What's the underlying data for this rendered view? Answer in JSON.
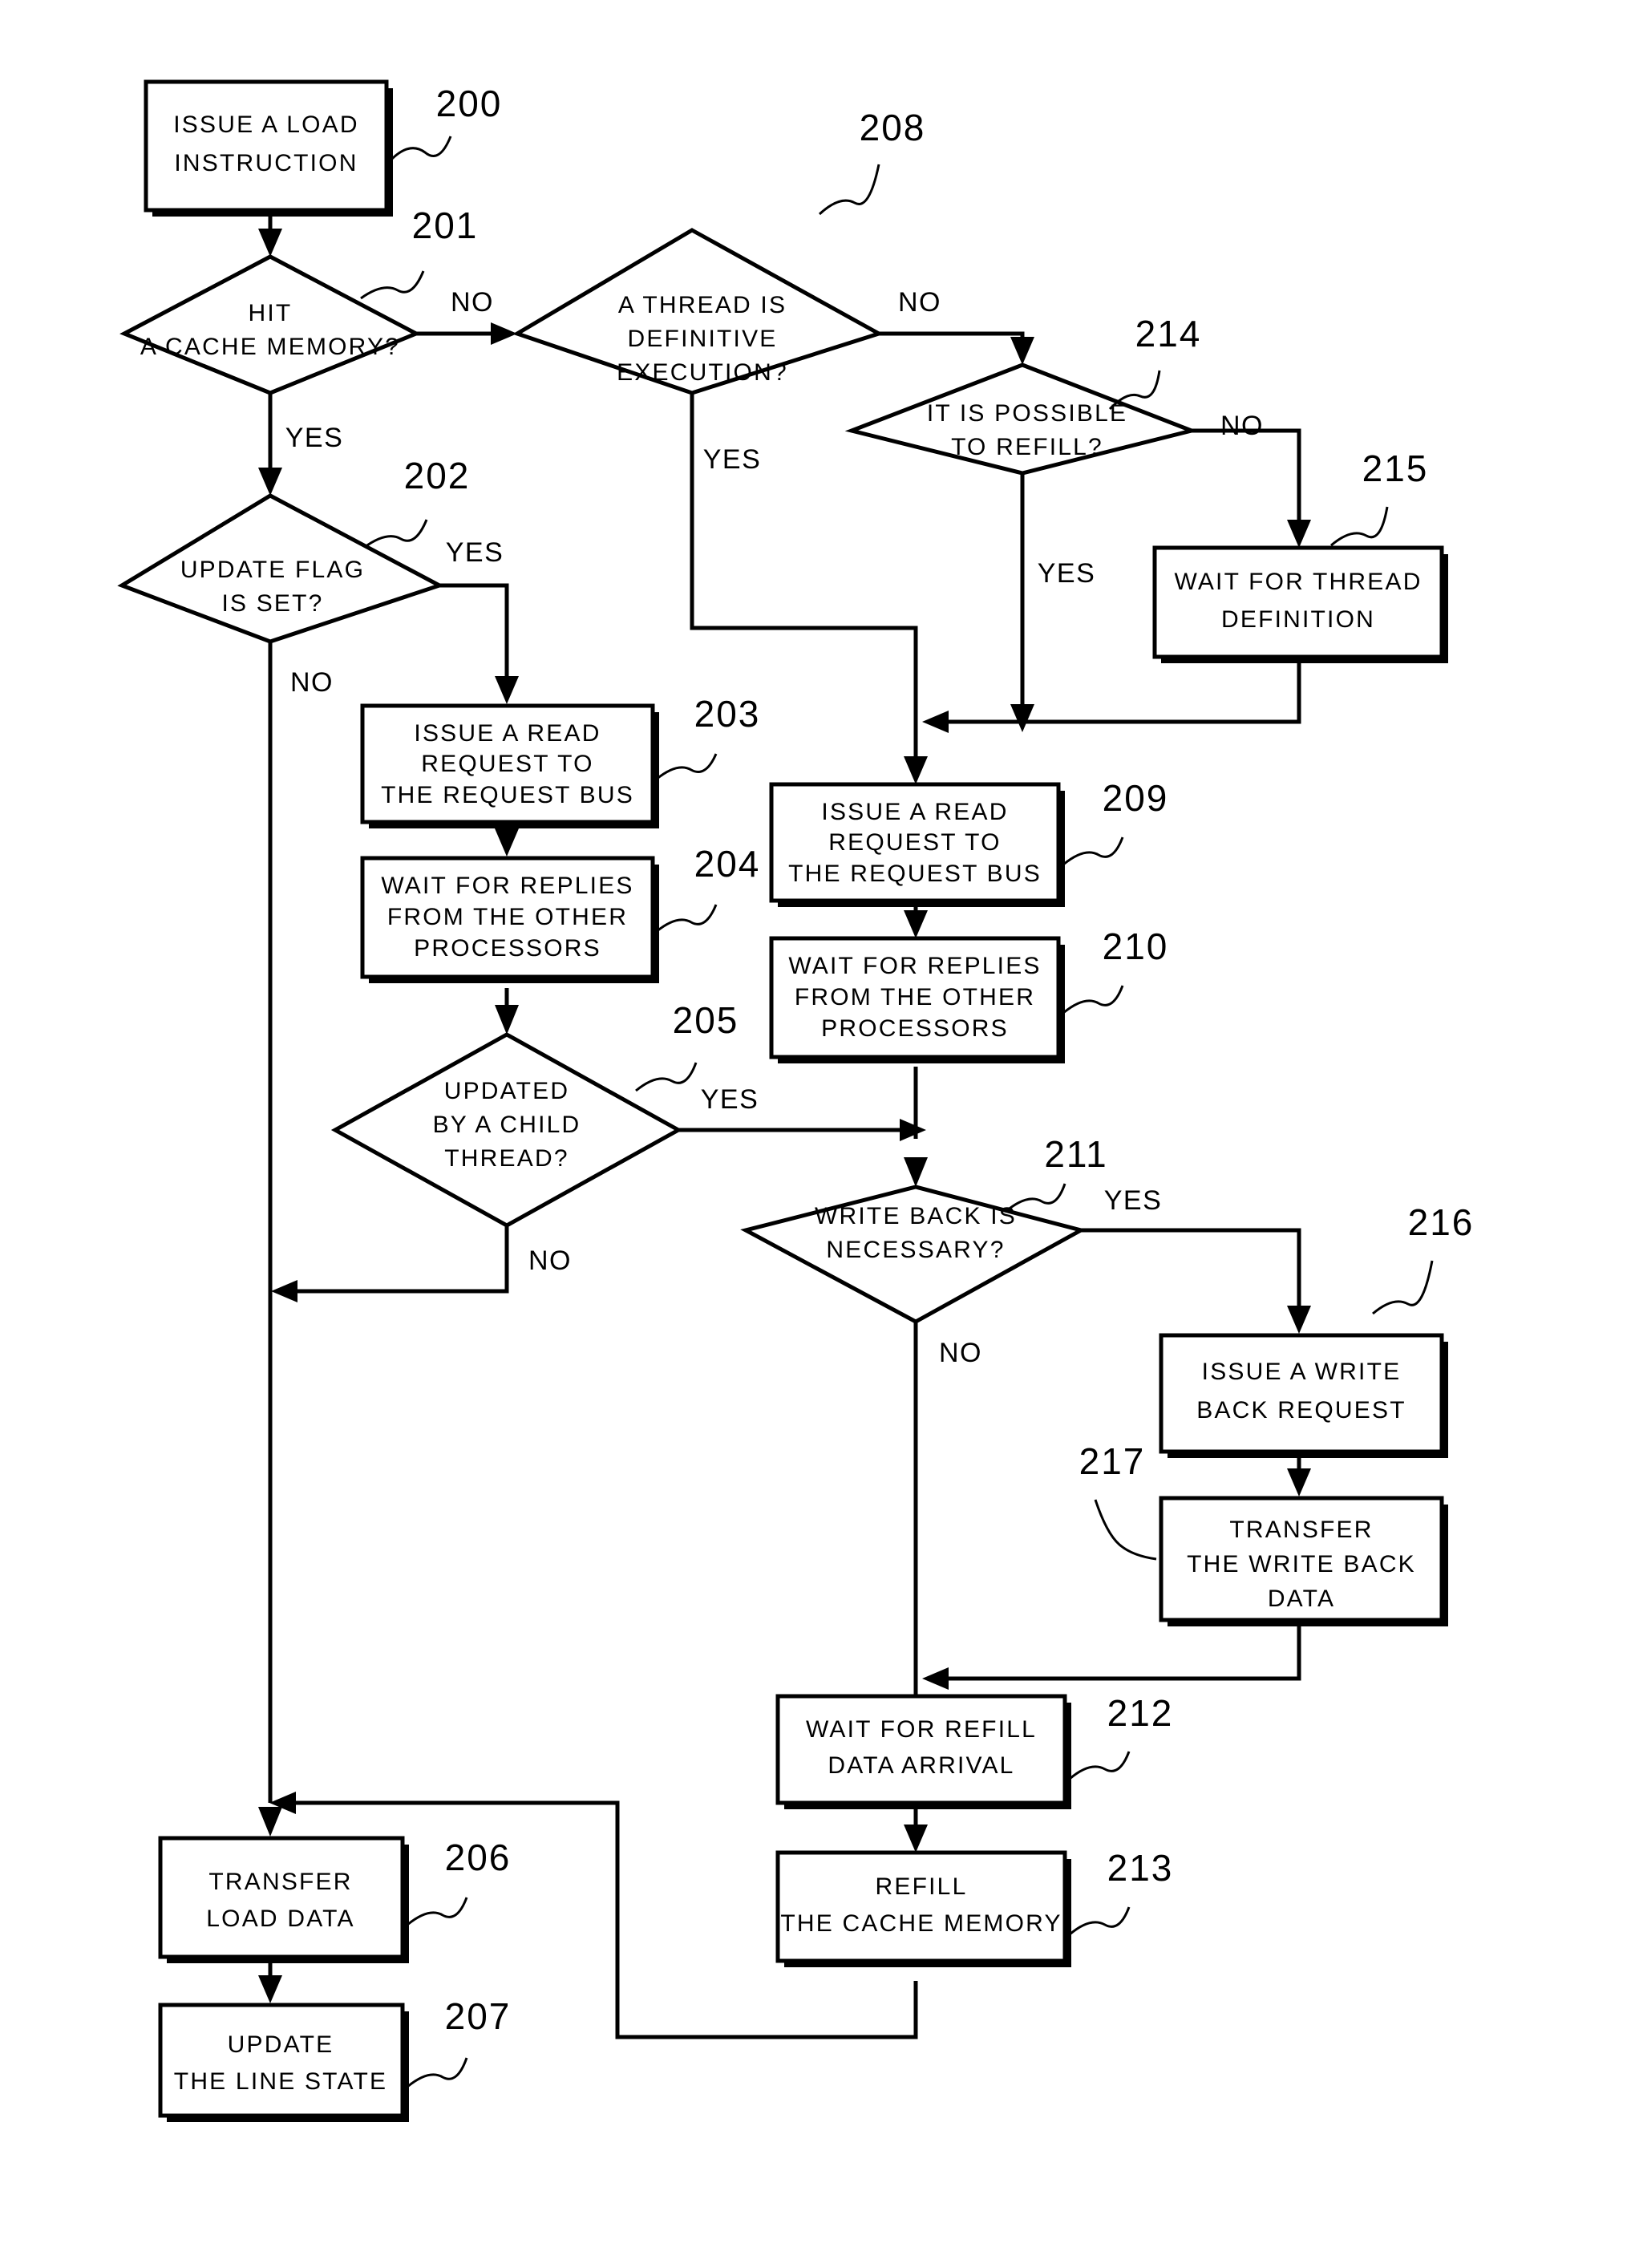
{
  "figure": {
    "type": "patent-flowchart",
    "title": "Cache memory load instruction processing flowchart",
    "background_color": "#ffffff",
    "line_color": "#000000"
  },
  "nodes": [
    {
      "ref": "200",
      "kind": "process",
      "lines": [
        "ISSUE A LOAD",
        "INSTRUCTION"
      ]
    },
    {
      "ref": "201",
      "kind": "decision",
      "lines": [
        "HIT",
        "A CACHE MEMORY?"
      ]
    },
    {
      "ref": "202",
      "kind": "decision",
      "lines": [
        "UPDATE FLAG",
        "IS SET?"
      ]
    },
    {
      "ref": "203",
      "kind": "process",
      "lines": [
        "ISSUE A READ",
        "REQUEST TO",
        "THE REQUEST BUS"
      ]
    },
    {
      "ref": "204",
      "kind": "process",
      "lines": [
        "WAIT FOR REPLIES",
        "FROM THE OTHER",
        "PROCESSORS"
      ]
    },
    {
      "ref": "205",
      "kind": "decision",
      "lines": [
        "UPDATED",
        "BY A CHILD",
        "THREAD?"
      ]
    },
    {
      "ref": "206",
      "kind": "process",
      "lines": [
        "TRANSFER",
        "LOAD DATA"
      ]
    },
    {
      "ref": "207",
      "kind": "process",
      "lines": [
        "UPDATE",
        "THE LINE STATE"
      ]
    },
    {
      "ref": "208",
      "kind": "decision",
      "lines": [
        "A THREAD IS",
        "DEFINITIVE",
        "EXECUTION?"
      ]
    },
    {
      "ref": "209",
      "kind": "process",
      "lines": [
        "ISSUE A READ",
        "REQUEST TO",
        "THE REQUEST BUS"
      ]
    },
    {
      "ref": "210",
      "kind": "process",
      "lines": [
        "WAIT FOR REPLIES",
        "FROM THE OTHER",
        "PROCESSORS"
      ]
    },
    {
      "ref": "211",
      "kind": "decision",
      "lines": [
        "WRITE BACK IS",
        "NECESSARY?"
      ]
    },
    {
      "ref": "212",
      "kind": "process",
      "lines": [
        "WAIT FOR REFILL",
        "DATA ARRIVAL"
      ]
    },
    {
      "ref": "213",
      "kind": "process",
      "lines": [
        "REFILL",
        "THE CACHE MEMORY"
      ]
    },
    {
      "ref": "214",
      "kind": "decision",
      "lines": [
        "IT IS POSSIBLE",
        "TO REFILL?"
      ]
    },
    {
      "ref": "215",
      "kind": "process",
      "lines": [
        "WAIT FOR THREAD",
        "DEFINITION"
      ]
    },
    {
      "ref": "216",
      "kind": "process",
      "lines": [
        "ISSUE A WRITE",
        "BACK REQUEST"
      ]
    },
    {
      "ref": "217",
      "kind": "process",
      "lines": [
        "TRANSFER",
        "THE WRITE BACK",
        "DATA"
      ]
    }
  ],
  "branch_labels": {
    "n201_no": "NO",
    "n201_yes": "YES",
    "n202_yes": "YES",
    "n202_no": "NO",
    "n205_yes": "YES",
    "n205_no": "NO",
    "n208_no": "NO",
    "n208_yes": "YES",
    "n211_yes": "YES",
    "n211_no": "NO",
    "n214_no": "NO",
    "n214_yes": "YES"
  },
  "node_text": {
    "n200_l0": "ISSUE A LOAD",
    "n200_l1": "INSTRUCTION",
    "n201_l0": "HIT",
    "n201_l1": "A CACHE MEMORY?",
    "n202_l0": "UPDATE FLAG",
    "n202_l1": "IS SET?",
    "n203_l0": "ISSUE A READ",
    "n203_l1": "REQUEST TO",
    "n203_l2": "THE REQUEST BUS",
    "n204_l0": "WAIT FOR REPLIES",
    "n204_l1": "FROM THE OTHER",
    "n204_l2": "PROCESSORS",
    "n205_l0": "UPDATED",
    "n205_l1": "BY A CHILD",
    "n205_l2": "THREAD?",
    "n206_l0": "TRANSFER",
    "n206_l1": "LOAD DATA",
    "n207_l0": "UPDATE",
    "n207_l1": "THE LINE STATE",
    "n208_l0": "A THREAD IS",
    "n208_l1": "DEFINITIVE",
    "n208_l2": "EXECUTION?",
    "n209_l0": "ISSUE A READ",
    "n209_l1": "REQUEST TO",
    "n209_l2": "THE REQUEST BUS",
    "n210_l0": "WAIT FOR REPLIES",
    "n210_l1": "FROM THE OTHER",
    "n210_l2": "PROCESSORS",
    "n211_l0": "WRITE BACK IS",
    "n211_l1": "NECESSARY?",
    "n212_l0": "WAIT FOR REFILL",
    "n212_l1": "DATA ARRIVAL",
    "n213_l0": "REFILL",
    "n213_l1": "THE CACHE MEMORY",
    "n214_l0": "IT IS POSSIBLE",
    "n214_l1": "TO REFILL?",
    "n215_l0": "WAIT FOR THREAD",
    "n215_l1": "DEFINITION",
    "n216_l0": "ISSUE A WRITE",
    "n216_l1": "BACK REQUEST",
    "n217_l0": "TRANSFER",
    "n217_l1": "THE WRITE BACK",
    "n217_l2": "DATA"
  },
  "ref_numbers": {
    "r200": "200",
    "r201": "201",
    "r202": "202",
    "r203": "203",
    "r204": "204",
    "r205": "205",
    "r206": "206",
    "r207": "207",
    "r208": "208",
    "r209": "209",
    "r210": "210",
    "r211": "211",
    "r212": "212",
    "r213": "213",
    "r214": "214",
    "r215": "215",
    "r216": "216",
    "r217": "217"
  }
}
